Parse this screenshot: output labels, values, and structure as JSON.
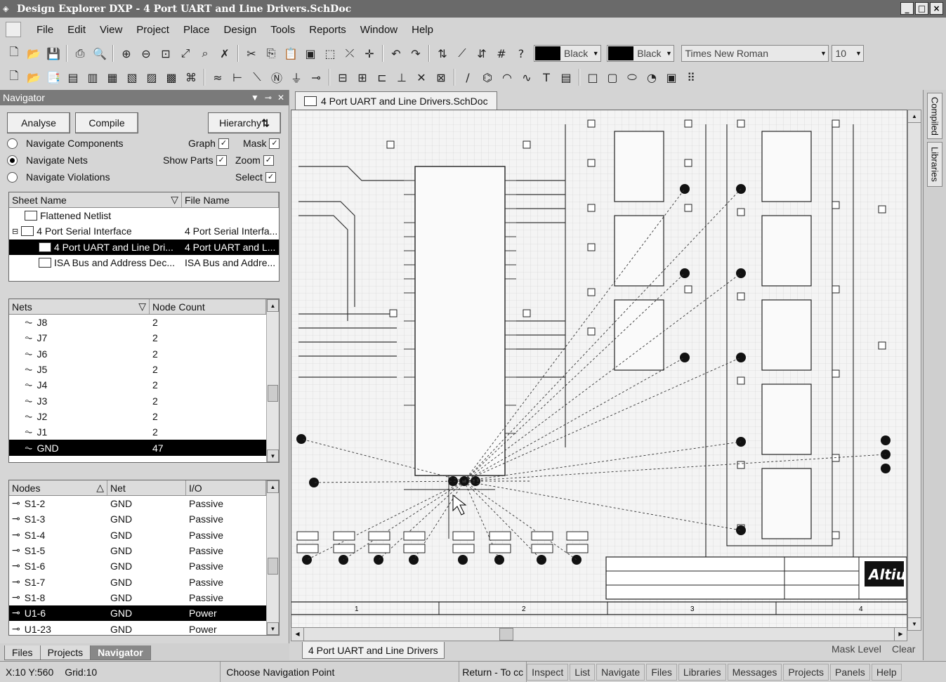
{
  "window": {
    "title": "Design Explorer DXP - 4 Port UART and Line Drivers.SchDoc"
  },
  "menu": [
    "File",
    "Edit",
    "View",
    "Project",
    "Place",
    "Design",
    "Tools",
    "Reports",
    "Window",
    "Help"
  ],
  "toolbar": {
    "wire_color": "Black",
    "fill_color": "Black",
    "font_name": "Times New Roman",
    "font_size": "10"
  },
  "navigator": {
    "title": "Navigator",
    "analyse_label": "Analyse",
    "compile_label": "Compile",
    "hierarchy_label": "Hierarchy",
    "options": {
      "navigate_components": "Navigate Components",
      "navigate_nets": "Navigate Nets",
      "navigate_violations": "Navigate Violations",
      "graph": "Graph",
      "mask": "Mask",
      "show_parts": "Show Parts",
      "zoom": "Zoom",
      "select": "Select"
    },
    "sheets": {
      "headers": [
        "Sheet Name",
        "File Name"
      ],
      "rows": [
        {
          "name": "Flattened Netlist",
          "file": ""
        },
        {
          "name": "4 Port Serial Interface",
          "file": "4 Port Serial Interfa..."
        },
        {
          "name": "4 Port UART and Line Dri...",
          "file": "4 Port UART and L..."
        },
        {
          "name": "ISA Bus and Address Dec...",
          "file": "ISA Bus and Addre..."
        }
      ]
    },
    "nets": {
      "headers": [
        "Nets",
        "Node Count"
      ],
      "rows": [
        {
          "name": "J8",
          "count": "2"
        },
        {
          "name": "J7",
          "count": "2"
        },
        {
          "name": "J6",
          "count": "2"
        },
        {
          "name": "J5",
          "count": "2"
        },
        {
          "name": "J4",
          "count": "2"
        },
        {
          "name": "J3",
          "count": "2"
        },
        {
          "name": "J2",
          "count": "2"
        },
        {
          "name": "J1",
          "count": "2"
        },
        {
          "name": "GND",
          "count": "47"
        }
      ]
    },
    "nodes": {
      "headers": [
        "Nodes",
        "Net",
        "I/O"
      ],
      "rows": [
        {
          "node": "S1-2",
          "net": "GND",
          "io": "Passive"
        },
        {
          "node": "S1-3",
          "net": "GND",
          "io": "Passive"
        },
        {
          "node": "S1-4",
          "net": "GND",
          "io": "Passive"
        },
        {
          "node": "S1-5",
          "net": "GND",
          "io": "Passive"
        },
        {
          "node": "S1-6",
          "net": "GND",
          "io": "Passive"
        },
        {
          "node": "S1-7",
          "net": "GND",
          "io": "Passive"
        },
        {
          "node": "S1-8",
          "net": "GND",
          "io": "Passive"
        },
        {
          "node": "U1-6",
          "net": "GND",
          "io": "Power"
        },
        {
          "node": "U1-23",
          "net": "GND",
          "io": "Power"
        }
      ]
    },
    "bottom_tabs": [
      "Files",
      "Projects",
      "Navigator"
    ]
  },
  "document": {
    "tab_label": "4 Port UART and Line Drivers.SchDoc",
    "sheet_tab": "4 Port UART and Line Drivers",
    "mask_level": "Mask Level",
    "clear": "Clear",
    "logo_text": "Altiu",
    "zone_labels": [
      "1",
      "2",
      "3",
      "4"
    ]
  },
  "right_panels": [
    "Compiled",
    "Libraries"
  ],
  "statusbar": {
    "coords": "X:10 Y:560",
    "grid": "Grid:10",
    "message": "Choose Navigation Point",
    "return": "Return - To cc",
    "buttons": [
      "Inspect",
      "List",
      "Navigate",
      "Files",
      "Libraries",
      "Messages",
      "Projects",
      "Panels",
      "Help"
    ]
  }
}
